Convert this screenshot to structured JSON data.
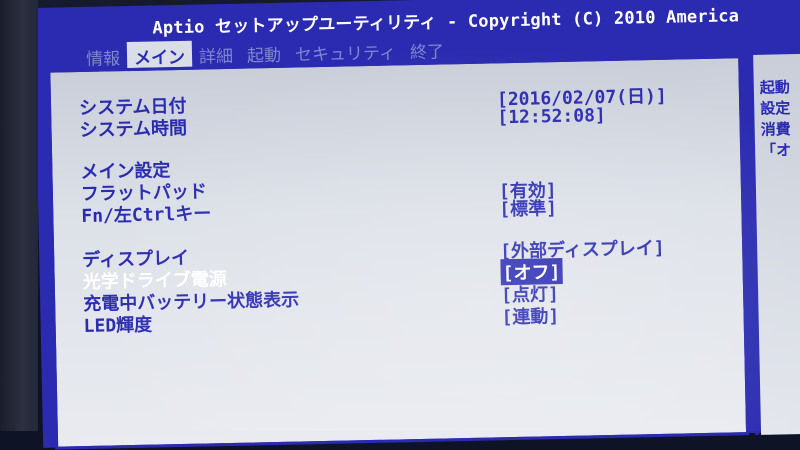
{
  "header": {
    "title": "Aptio セットアップユーティリティ - Copyright (C) 2010 America"
  },
  "tabs": [
    {
      "label": "情報"
    },
    {
      "label": "メイン"
    },
    {
      "label": "詳細"
    },
    {
      "label": "起動"
    },
    {
      "label": "セキュリティ"
    },
    {
      "label": "終了"
    }
  ],
  "main": {
    "date": {
      "label": "システム日付",
      "value": "[2016/02/07(日)]"
    },
    "time": {
      "label": "システム時間",
      "value": "[12:52:08]"
    },
    "main_settings_heading": "メイン設定",
    "flatpad": {
      "label": "フラットパッド",
      "value": "[有効]"
    },
    "fn_ctrl": {
      "label": "Fn/左Ctrlキー",
      "value": "[標準]"
    },
    "display": {
      "label": "ディスプレイ",
      "value": "[外部ディスプレイ]"
    },
    "optical_power": {
      "label": "光学ドライブ電源",
      "value": "[オフ]"
    },
    "battery_status": {
      "label": "充電中バッテリー状態表示",
      "value": "[点灯]"
    },
    "led_brightness": {
      "label": "LED輝度",
      "value": "[連動]"
    }
  },
  "help": {
    "lines": [
      "起動",
      "設定",
      "消費",
      "「オ"
    ]
  },
  "colors": {
    "bios_blue": "#2a2bb0",
    "panel_gray": "#d9dde6",
    "highlight_text": "#ffffff"
  }
}
